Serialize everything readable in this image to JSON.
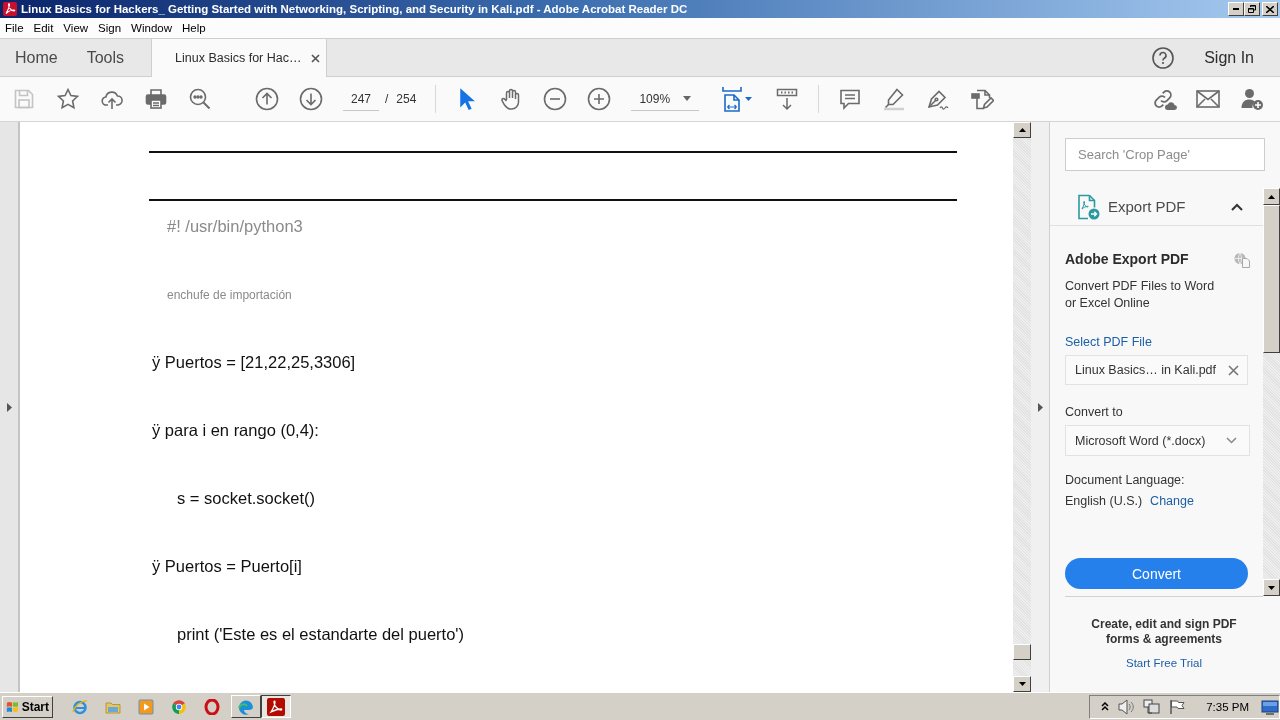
{
  "window": {
    "title": "Linux Basics for Hackers_ Getting Started with Networking, Scripting, and Security in Kali.pdf - Adobe Acrobat Reader DC"
  },
  "menu": [
    "File",
    "Edit",
    "View",
    "Sign",
    "Window",
    "Help"
  ],
  "tabs": [
    {
      "label": "Home",
      "selected": false,
      "closable": false
    },
    {
      "label": "Tools",
      "selected": false,
      "closable": false
    },
    {
      "label": "Linux Basics for Hac…",
      "selected": true,
      "closable": true
    }
  ],
  "account": {
    "sign_in": "Sign In"
  },
  "toolbar": {
    "save_disabled": true,
    "page_current": "247",
    "page_separator": "/",
    "page_total": "254",
    "tools": [
      {
        "kind": "select",
        "selected": true
      },
      {
        "kind": "hand",
        "selected": false
      }
    ],
    "zoom": "109%",
    "fit_selected": true
  },
  "document": {
    "lines": [
      {
        "kind": "shebang",
        "text": "#! /usr/bin/python3"
      },
      {
        "kind": "note",
        "text": "enchufe de importación"
      },
      {
        "kind": "code",
        "text": "ÿ Puertos = [21,22,25,3306]"
      },
      {
        "kind": "code",
        "text": "ÿ para i en rango (0,4):"
      },
      {
        "kind": "indented",
        "text": "s = socket.socket()"
      },
      {
        "kind": "code",
        "text": "ÿ Puertos = Puerto[i]"
      },
      {
        "kind": "indented",
        "text": "print ('Este es el estandarte del puerto')"
      }
    ]
  },
  "search": {
    "placeholder": "Search 'Crop Page'"
  },
  "export_panel": {
    "title": "Export PDF",
    "expanded": true,
    "heading": "Adobe Export PDF",
    "description": "Convert PDF Files to Word or Excel Online",
    "select_link": "Select PDF File",
    "file": "Linux Basics… in Kali.pdf",
    "convert_to_label": "Convert to",
    "format": "Microsoft Word (*.docx)",
    "language_label": "Document Language:",
    "language": "English (U.S.)",
    "change_link": "Change",
    "convert_button": "Convert"
  },
  "promo": {
    "text": "Create, edit and sign PDF forms & agreements",
    "link": "Start Free Trial"
  },
  "taskbar": {
    "start": "Start",
    "windows": [
      {
        "selected": false
      },
      {
        "selected": true
      }
    ],
    "clock": "7:35 PM"
  }
}
